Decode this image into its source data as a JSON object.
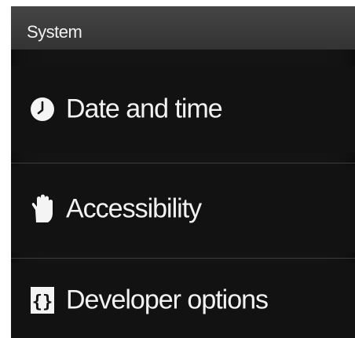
{
  "section": {
    "title": "System"
  },
  "items": [
    {
      "label": "Date and time",
      "icon": "clock-icon"
    },
    {
      "label": "Accessibility",
      "icon": "hand-icon"
    },
    {
      "label": "Developer options",
      "icon": "braces-icon"
    }
  ],
  "colors": {
    "background": "#141414",
    "header": "#3a3a3a",
    "text": "#f2f2f2",
    "divider": "#3c3c3c"
  }
}
